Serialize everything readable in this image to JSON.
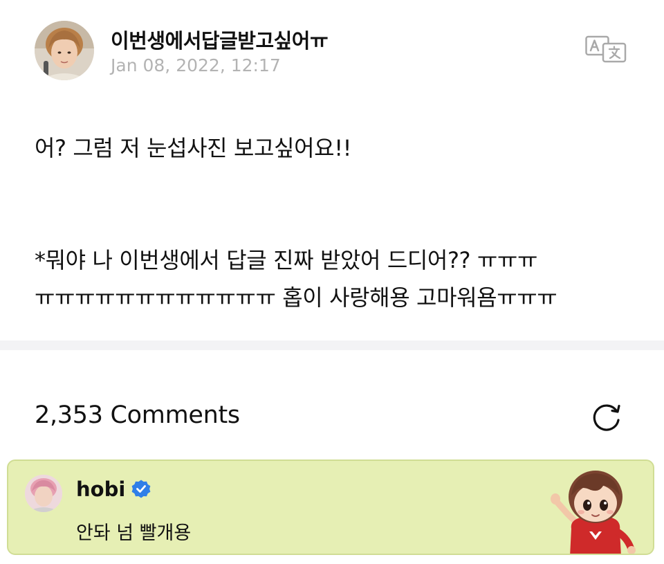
{
  "post": {
    "author": "이번생에서답글받고싶어ㅠ",
    "date": "Jan 08, 2022, 12:17",
    "body_line1": "어? 그럼 저 눈섭사진 보고싶어요!!",
    "body_line2": "*뭐야 나 이번생에서 답글 진짜 받았어 드디어?? ㅠㅠㅠ",
    "body_line3": "ㅠㅠㅠㅠㅠㅠㅠㅠㅠㅠㅠㅠ 홉이 사랑해용 고마워욤ㅠㅠㅠ"
  },
  "comments": {
    "count_label": "2,353 Comments",
    "highlighted": {
      "author": "hobi",
      "text": "안돠 넘 빨개용"
    }
  },
  "icons": {
    "translate": "translate-icon",
    "refresh": "refresh-icon",
    "verified": "verified-badge-icon"
  },
  "colors": {
    "highlight_bg": "#e6efb4",
    "verified_blue": "#2f7fe8",
    "date_gray": "#b3b3b3"
  }
}
